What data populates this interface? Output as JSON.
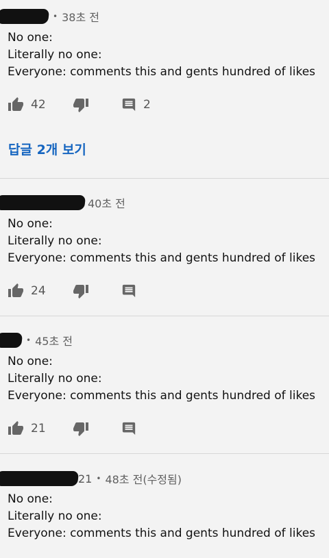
{
  "comments": [
    {
      "username_redacted": true,
      "timestamp": "38초 전",
      "lines": [
        "No one:",
        "Literally no one:",
        "Everyone: comments this and gents hundred of likes"
      ],
      "likes": "42",
      "reply_count": "2",
      "view_replies": "답글 2개 보기"
    },
    {
      "username_redacted": true,
      "timestamp": "40초 전",
      "lines": [
        "No one:",
        "Literally no one:",
        "Everyone: comments this and gents hundred of likes"
      ],
      "likes": "24"
    },
    {
      "username_redacted": true,
      "timestamp": "45초 전",
      "lines": [
        "No one:",
        "Literally no one:",
        "Everyone: comments this and gents hundred of likes"
      ],
      "likes": "21"
    },
    {
      "username_redacted": true,
      "username_partial": "21",
      "timestamp": "48초 전(수정됨)",
      "lines": [
        "No one:",
        "Literally no one:",
        "Everyone: comments this and gents hundred of likes"
      ]
    }
  ],
  "icons": {
    "like": "thumbs-up-icon",
    "dislike": "thumbs-down-icon",
    "reply": "comment-icon"
  },
  "colors": {
    "background": "#f3f3f3",
    "link": "#1565c0",
    "icon": "#666666"
  }
}
